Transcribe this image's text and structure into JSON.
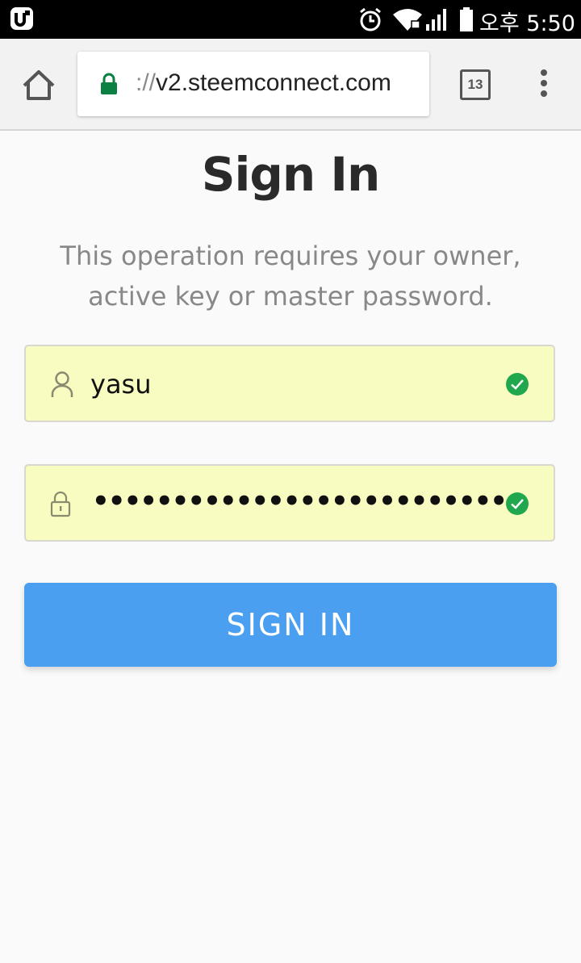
{
  "status_bar": {
    "time": "오후 5:50",
    "icons": [
      "app-icon",
      "alarm-icon",
      "wifi-icon",
      "signal-icon",
      "battery-icon"
    ]
  },
  "browser": {
    "url_scheme": "://",
    "url_host": "v2.steemconnect.com",
    "tab_count": "13",
    "icons": [
      "home-icon",
      "lock-icon",
      "tabs-icon",
      "more-vert-icon"
    ]
  },
  "page": {
    "title": "Sign In",
    "description": "This operation requires your owner, active key or master password.",
    "username": {
      "value": "yasu",
      "icon": "user-icon",
      "valid": true
    },
    "password": {
      "masked_value": "••••••••••••••••••••••••••••••••••••",
      "icon": "lock-icon",
      "valid": true
    },
    "submit_label": "SIGN IN"
  },
  "colors": {
    "status_bar": "#000000",
    "toolbar": "#f2f2f2",
    "lock_green": "#0b8043",
    "field_bg": "#f9fcc0",
    "check_green": "#21a84f",
    "button": "#4a9ff0"
  }
}
